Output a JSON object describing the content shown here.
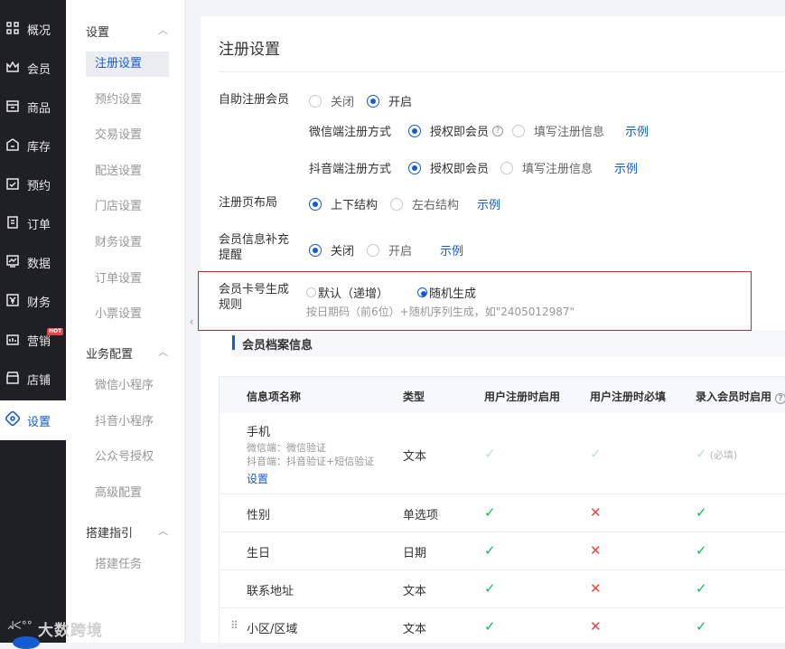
{
  "nav": [
    {
      "label": "概况",
      "icon": "grid-icon"
    },
    {
      "label": "会员",
      "icon": "crown-icon"
    },
    {
      "label": "商品",
      "icon": "shop-icon"
    },
    {
      "label": "库存",
      "icon": "warehouse-icon"
    },
    {
      "label": "预约",
      "icon": "calendar-check-icon"
    },
    {
      "label": "订单",
      "icon": "order-icon"
    },
    {
      "label": "数据",
      "icon": "chart-icon"
    },
    {
      "label": "财务",
      "icon": "yen-icon"
    },
    {
      "label": "营销",
      "icon": "marketing-icon",
      "badge": "HOT"
    },
    {
      "label": "店铺",
      "icon": "store-icon"
    },
    {
      "label": "设置",
      "icon": "settings-icon",
      "active": true
    }
  ],
  "sub": {
    "group1": "设置",
    "items1": [
      "注册设置",
      "预约设置",
      "交易设置",
      "配送设置",
      "门店设置",
      "财务设置",
      "订单设置",
      "小票设置"
    ],
    "group2": "业务配置",
    "items2": [
      "微信小程序",
      "抖音小程序",
      "公众号授权",
      "高级配置"
    ],
    "group3": "搭建指引",
    "items3": [
      "搭建任务"
    ]
  },
  "page": {
    "title": "注册设置",
    "self_reg": {
      "label": "自助注册会员",
      "off": "关闭",
      "on": "开启"
    },
    "wechat": {
      "label": "微信端注册方式",
      "opt1": "授权即会员",
      "opt2": "填写注册信息",
      "example": "示例"
    },
    "douyin": {
      "label": "抖音端注册方式",
      "opt1": "授权即会员",
      "opt2": "填写注册信息",
      "example": "示例"
    },
    "layout": {
      "label": "注册页布局",
      "opt1": "上下结构",
      "opt2": "左右结构",
      "example": "示例"
    },
    "remind": {
      "label": "会员信息补充提醒",
      "opt1": "关闭",
      "opt2": "开启",
      "example": "示例"
    },
    "cardno": {
      "label": "会员卡号生成规则",
      "opt1": "默认（递增）",
      "opt2": "随机生成",
      "hint": "按日期码（前6位）+随机序列生成，如\"2405012987\""
    },
    "section": "会员档案信息",
    "table": {
      "headers": [
        "信息项名称",
        "类型",
        "用户注册时启用",
        "用户注册时必填",
        "录入会员时启用"
      ],
      "rows": [
        {
          "name": "手机",
          "sub1": "微信端：微信验证",
          "sub2": "抖音端：抖音验证+短信验证",
          "link": "设置",
          "type": "文本",
          "c1": "light",
          "c2": "light",
          "c3": "light",
          "must": "(必填)"
        },
        {
          "name": "性别",
          "type": "单选项",
          "c1": "yes",
          "c2": "no",
          "c3": "yes"
        },
        {
          "name": "生日",
          "type": "日期",
          "c1": "yes",
          "c2": "no",
          "c3": "yes"
        },
        {
          "name": "联系地址",
          "type": "文本",
          "c1": "yes",
          "c2": "no",
          "c3": "yes"
        },
        {
          "name": "小区/区域",
          "type": "文本",
          "c1": "yes",
          "c2": "no",
          "c3": "yes"
        }
      ]
    }
  },
  "watermark": "大数跨境",
  "colors": {
    "accent": "#155bd4",
    "nav_bg": "#1f2024",
    "check": "#07c160",
    "cross": "#e64545",
    "highlight_box": "#c8282b"
  }
}
